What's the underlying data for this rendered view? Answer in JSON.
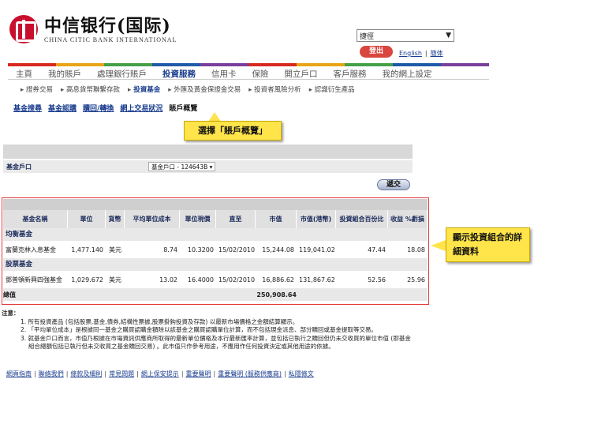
{
  "brand": {
    "name_cn": "中信银行(国际)",
    "name_en": "CHINA CITIC BANK INTERNATIONAL"
  },
  "header": {
    "language_select": "捷徑",
    "logout": "登出",
    "links": [
      "English",
      "簡体"
    ]
  },
  "colorbar": [
    "#d7291f",
    "#e9a416",
    "#43a047",
    "#1e5aa8",
    "#7a3e9d",
    "#d7291f",
    "#e9a416",
    "#43a047",
    "#1e5aa8",
    "#7a3e9d"
  ],
  "mainnav": [
    "主頁",
    "我的賬戶",
    "處理銀行賬戶",
    "投資服務",
    "信用卡",
    "保險",
    "開立戶口",
    "客戶服務",
    "我的網上設定"
  ],
  "mainnav_active": "投資服務",
  "subnav": [
    "證券交易",
    "高息貨幣聯繫存款",
    "投資基金",
    "外匯及黃金保證金交易",
    "投資者風險分析",
    "認識衍生產品"
  ],
  "subnav_active": "投資基金",
  "tabs": [
    "基金搜尋",
    "基金認購",
    "贖回/轉換",
    "網上交易狀況",
    "賬戶概覽"
  ],
  "tabs_active": "賬戶概覽",
  "callouts": {
    "select_overview": "選擇「賬戶概覽」",
    "show_details": "顯示投資組合的詳細資料"
  },
  "account": {
    "label": "基金戶口",
    "value": "基金戶口 - 124643B"
  },
  "submit": "遞交",
  "table": {
    "headers": [
      "基金名稱",
      "單位",
      "貨幣",
      "平均單位成本",
      "單位現價",
      "直至",
      "市值",
      "市值(港幣)",
      "投資組合百份比",
      "收益 %虧損"
    ],
    "groups": [
      {
        "category": "均衡基金",
        "rows": [
          [
            "富蘭克林入息基金",
            "1,477.140",
            "美元",
            "8.74",
            "10.3200",
            "15/02/2010",
            "15,244.08",
            "119,041.02",
            "47.44",
            "18.08"
          ]
        ]
      },
      {
        "category": "股票基金",
        "rows": [
          [
            "鄧普頓新興四強基金",
            "1,029.672",
            "美元",
            "13.02",
            "16.4000",
            "15/02/2010",
            "16,886.62",
            "131,867.62",
            "52.56",
            "25.96"
          ]
        ]
      }
    ],
    "total_label": "總值",
    "total_value": "250,908.64"
  },
  "notes": {
    "title": "注意：",
    "items": [
      "1. 所有投資產品 (包括股票,基金,債券,結構性票據,股票掛鈎投資及存款) 以最新市場價格之金額結算顯示。",
      "2. 「平均單位成本」是根據同一基金之購買認購金額除以該基金之購買認購單位計算，而不包括現金派息、部分贖回或基金提取等交易。",
      "3. 就基金戶口而言，市值乃根據在市場資訊供應商所取得的最新單位價格及本行最新匯率計算，並包括已執行之贖回但仍未交收買的單位市值 (即基金",
      "組合總額包括已執行但未交收買之基金贖回交易) 。此市值只作參考用途，不應用作任何投資決定或其他用途的依據。"
    ]
  },
  "footer": [
    "網頁指南",
    "聯絡我們",
    "條款及細則",
    "常見問題",
    "網上保安提示",
    "重要聲明",
    "重要聲明 (服務供應商)",
    "私隱條文"
  ]
}
